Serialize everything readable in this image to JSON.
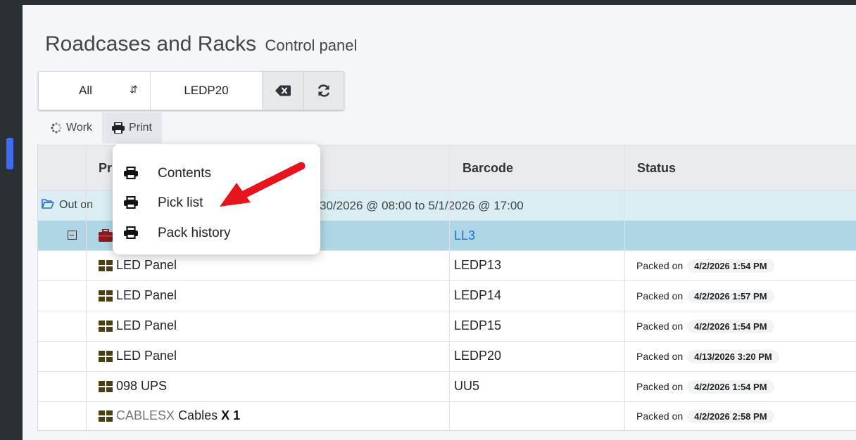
{
  "page": {
    "title": "Roadcases and Racks",
    "subtitle": "Control panel"
  },
  "filter": {
    "select_value": "All",
    "search_value": "LEDP20",
    "clear_icon": "backspace-icon",
    "refresh_icon": "refresh-icon"
  },
  "tabs": [
    {
      "label": "Work",
      "icon": "spinner-icon"
    },
    {
      "label": "Print",
      "icon": "printer-icon"
    }
  ],
  "print_menu": {
    "items": [
      "Contents",
      "Pick list",
      "Pack history"
    ]
  },
  "grid": {
    "columns": [
      "Pr",
      "Barcode",
      "Status"
    ],
    "group": {
      "label": "Out on",
      "dates": "30/2026 @ 08:00  to  5/1/2026 @ 17:00"
    },
    "parent": {
      "barcode": "LL3"
    },
    "rows": [
      {
        "name": "LED Panel",
        "barcode": "LEDP13",
        "status_label": "Packed on",
        "status_time": "4/2/2026 1:54 PM"
      },
      {
        "name": "LED Panel",
        "barcode": "LEDP14",
        "status_label": "Packed on",
        "status_time": "4/2/2026 1:57 PM"
      },
      {
        "name": "LED Panel",
        "barcode": "LEDP15",
        "status_label": "Packed on",
        "status_time": "4/2/2026 1:54 PM"
      },
      {
        "name": "LED Panel",
        "barcode": "LEDP20",
        "status_label": "Packed on",
        "status_time": "4/13/2026 3:20 PM"
      },
      {
        "name": "098 UPS",
        "barcode": "UU5",
        "status_label": "Packed on",
        "status_time": "4/2/2026 1:54 PM"
      }
    ],
    "last_row": {
      "code": "CABLESX",
      "name": "Cables",
      "qty": "X 1",
      "barcode": "",
      "status_label": "Packed on",
      "status_time": "4/2/2026 2:58 PM"
    }
  },
  "colors": {
    "sidebar": "#2b3035",
    "accent": "#3d6cf0",
    "group_row": "#d9edf3",
    "selected_row": "#aed6e4",
    "link": "#1c6fd6",
    "arrow": "#e8141c",
    "case_icon": "#8b1b1b",
    "item_icon": "#4a3f12"
  }
}
